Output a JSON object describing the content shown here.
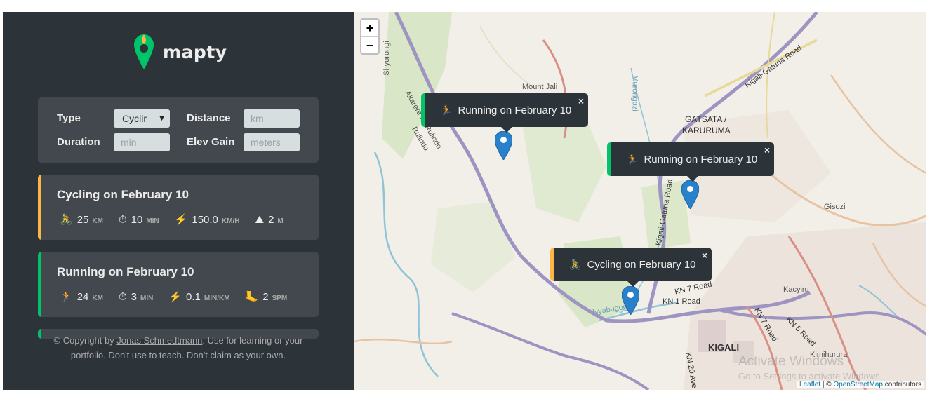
{
  "logo": {
    "text": "mapty",
    "icon": "map-pin-icon"
  },
  "form": {
    "type_label": "Type",
    "type_value": "Cyclir",
    "distance_label": "Distance",
    "distance_placeholder": "km",
    "duration_label": "Duration",
    "duration_placeholder": "min",
    "elev_label": "Elev Gain",
    "elev_placeholder": "meters"
  },
  "workouts": [
    {
      "title": "Cycling on February 10",
      "accent": "#ffb545",
      "details": [
        {
          "icon": "🚴",
          "value": "25",
          "unit": "km"
        },
        {
          "icon": "⏱",
          "value": "10",
          "unit": "min"
        },
        {
          "icon": "⚡",
          "value": "150.0",
          "unit": "km/h"
        },
        {
          "icon": "⛰",
          "value": "2",
          "unit": "m"
        }
      ]
    },
    {
      "title": "Running on February 10",
      "accent": "#00c46a",
      "details": [
        {
          "icon": "🏃",
          "value": "24",
          "unit": "km"
        },
        {
          "icon": "⏱",
          "value": "3",
          "unit": "min"
        },
        {
          "icon": "⚡",
          "value": "0.1",
          "unit": "min/km"
        },
        {
          "icon": "🦶",
          "value": "2",
          "unit": "spm"
        }
      ]
    }
  ],
  "copyright": {
    "prefix": "© Copyright by ",
    "author": "Jonas Schmedtmann",
    "suffix": ". Use for learning or your portfolio. Don't use to teach. Don't claim as your own."
  },
  "map": {
    "zoom_in": "+",
    "zoom_out": "−",
    "popups": [
      {
        "emoji": "🏃",
        "text": "Running on February 10",
        "close": "×"
      },
      {
        "emoji": "🏃",
        "text": "Running on February 10",
        "close": "×"
      },
      {
        "emoji": "🚴",
        "text": "Cycling on February 10",
        "close": "×"
      }
    ],
    "labels": {
      "mount_jali": "Mount Jali",
      "gatsata": "GATSATA /",
      "karuruma": "KARURUMA",
      "kigali": "KIGALI",
      "gisozi": "Gisozi",
      "kacyiru": "Kacyiru",
      "kimihurura": "Kimihurura",
      "rulindo": "Rulindo",
      "shyorongi": "Shyorongi",
      "murongozi": "Murongozi",
      "nyabugogo": "Nyabugogo",
      "kigali_gatuna_road": "Kigali-Gatuna Road",
      "kn7_road": "KN 7 Road",
      "kn1_road": "KN 1 Road",
      "kn5_road": "KN 5 Road",
      "kn20_ave": "KN 20 Ave",
      "akarere": "Akarere ka Rulindo"
    },
    "watermark_title": "Activate Windows",
    "watermark_sub": "Go to Settings to activate Windows.",
    "attribution": {
      "leaflet": "Leaflet",
      "sep": " | © ",
      "osm": "OpenStreetMap",
      "contributors": " contributors"
    }
  },
  "colors": {
    "running": "#00c46a",
    "cycling": "#ffb545",
    "panel": "#2d3439",
    "card": "#42484d"
  }
}
